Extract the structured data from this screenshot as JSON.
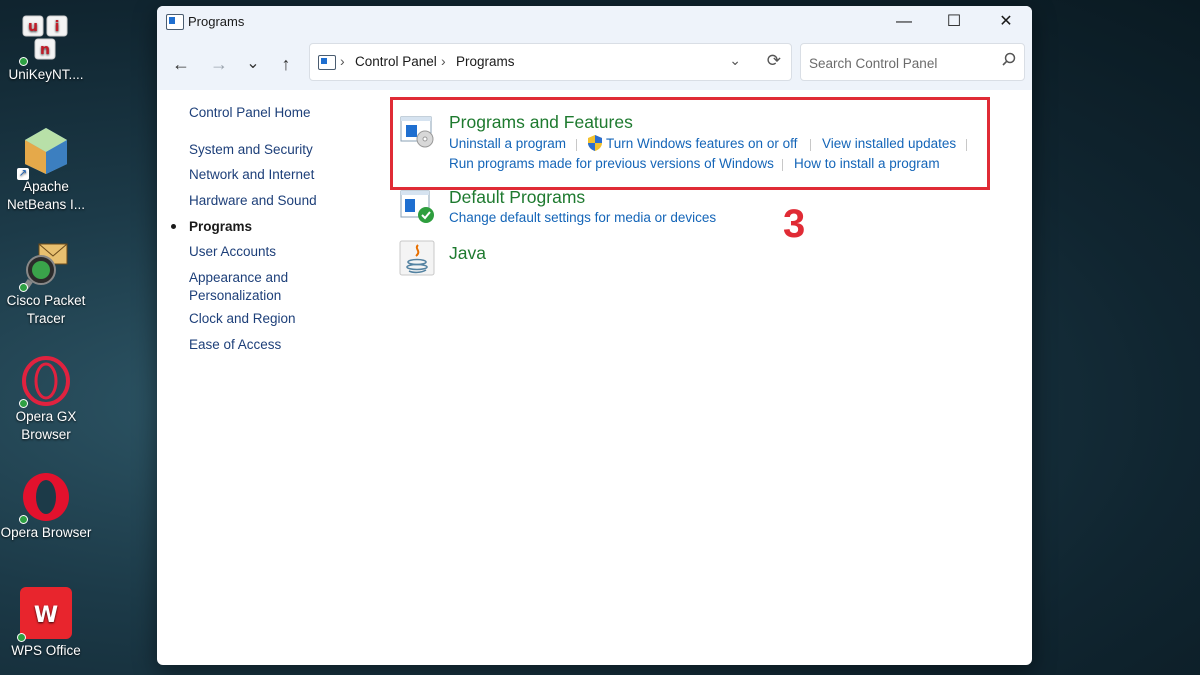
{
  "desktop": {
    "icons": [
      {
        "label": "UniKeyNT....",
        "icon": "unikey-icon"
      },
      {
        "label": "Apache NetBeans I...",
        "icon": "netbeans-icon"
      },
      {
        "label": "Cisco Packet Tracer",
        "icon": "packet-tracer-icon"
      },
      {
        "label": "Opera GX Browser",
        "icon": "opera-gx-icon"
      },
      {
        "label": "Opera Browser",
        "icon": "opera-icon"
      },
      {
        "label": "WPS Office",
        "icon": "wps-office-icon"
      }
    ]
  },
  "window": {
    "title": "Programs",
    "controls": {
      "minimize": "—",
      "maximize": "☐",
      "close": "✕"
    }
  },
  "nav": {
    "back": "←",
    "forward": "→",
    "recent": "⌄",
    "up": "↑",
    "breadcrumb": [
      "Control Panel",
      "Programs"
    ],
    "search_placeholder": "Search Control Panel"
  },
  "sidebar": {
    "home": "Control Panel Home",
    "items": [
      {
        "label": "System and Security",
        "current": false
      },
      {
        "label": "Network and Internet",
        "current": false
      },
      {
        "label": "Hardware and Sound",
        "current": false
      },
      {
        "label": "Programs",
        "current": true
      },
      {
        "label": "User Accounts",
        "current": false
      },
      {
        "label": "Appearance and Personalization",
        "current": false
      },
      {
        "label": "Clock and Region",
        "current": false
      },
      {
        "label": "Ease of Access",
        "current": false
      }
    ]
  },
  "categories": [
    {
      "title": "Programs and Features",
      "icon": "programs-features-icon",
      "links": [
        "Uninstall a program",
        "Turn Windows features on or off",
        "View installed updates",
        "Run programs made for previous versions of Windows",
        "How to install a program"
      ]
    },
    {
      "title": "Default Programs",
      "icon": "default-programs-icon",
      "links": [
        "Change default settings for media or devices"
      ]
    },
    {
      "title": "Java",
      "icon": "java-icon",
      "links": []
    }
  ],
  "annotation": {
    "step": "3",
    "color": "#e02b35"
  },
  "colors": {
    "category_title": "#1e7a2f",
    "link": "#1465b8",
    "sidebar_link": "#1d3f79"
  }
}
